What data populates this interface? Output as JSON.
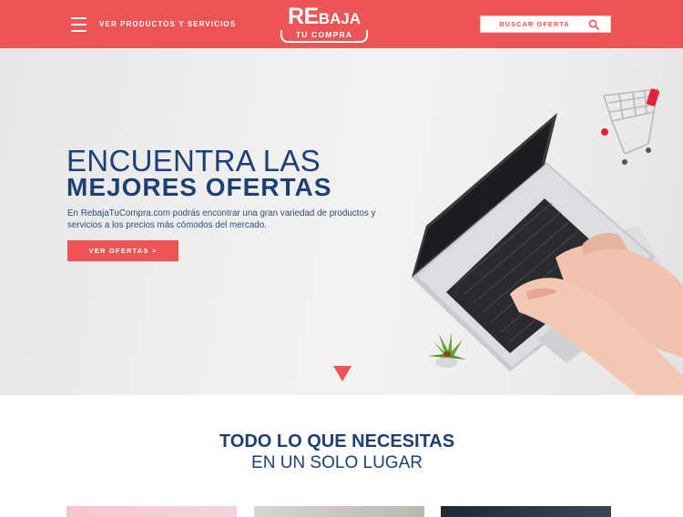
{
  "header": {
    "nav_label": "VER PRODUCTOS Y SERVICIOS",
    "logo_top_big": "RE",
    "logo_top_small": "BAJA",
    "logo_bottom": "TU COMPRA",
    "search_placeholder": "BUSCAR OFERTA",
    "background_color": "#ec5456"
  },
  "hero": {
    "title_line1": "ENCUENTRA LAS",
    "title_line2": "MEJORES OFERTAS",
    "description": "En RebajaTuCompra.com podrás encontrar una gran variedad de productos y servicios a los precios más cómodos del mercado.",
    "button_label": "VER OFERTAS  >"
  },
  "section": {
    "title_line1": "TODO LO QUE NECESITAS",
    "title_line2": "EN UN SOLO LUGAR"
  },
  "colors": {
    "accent": "#ec5456",
    "navy": "#1f3f73"
  },
  "icons": [
    "menu-icon",
    "search-icon",
    "chevron-down-icon"
  ]
}
